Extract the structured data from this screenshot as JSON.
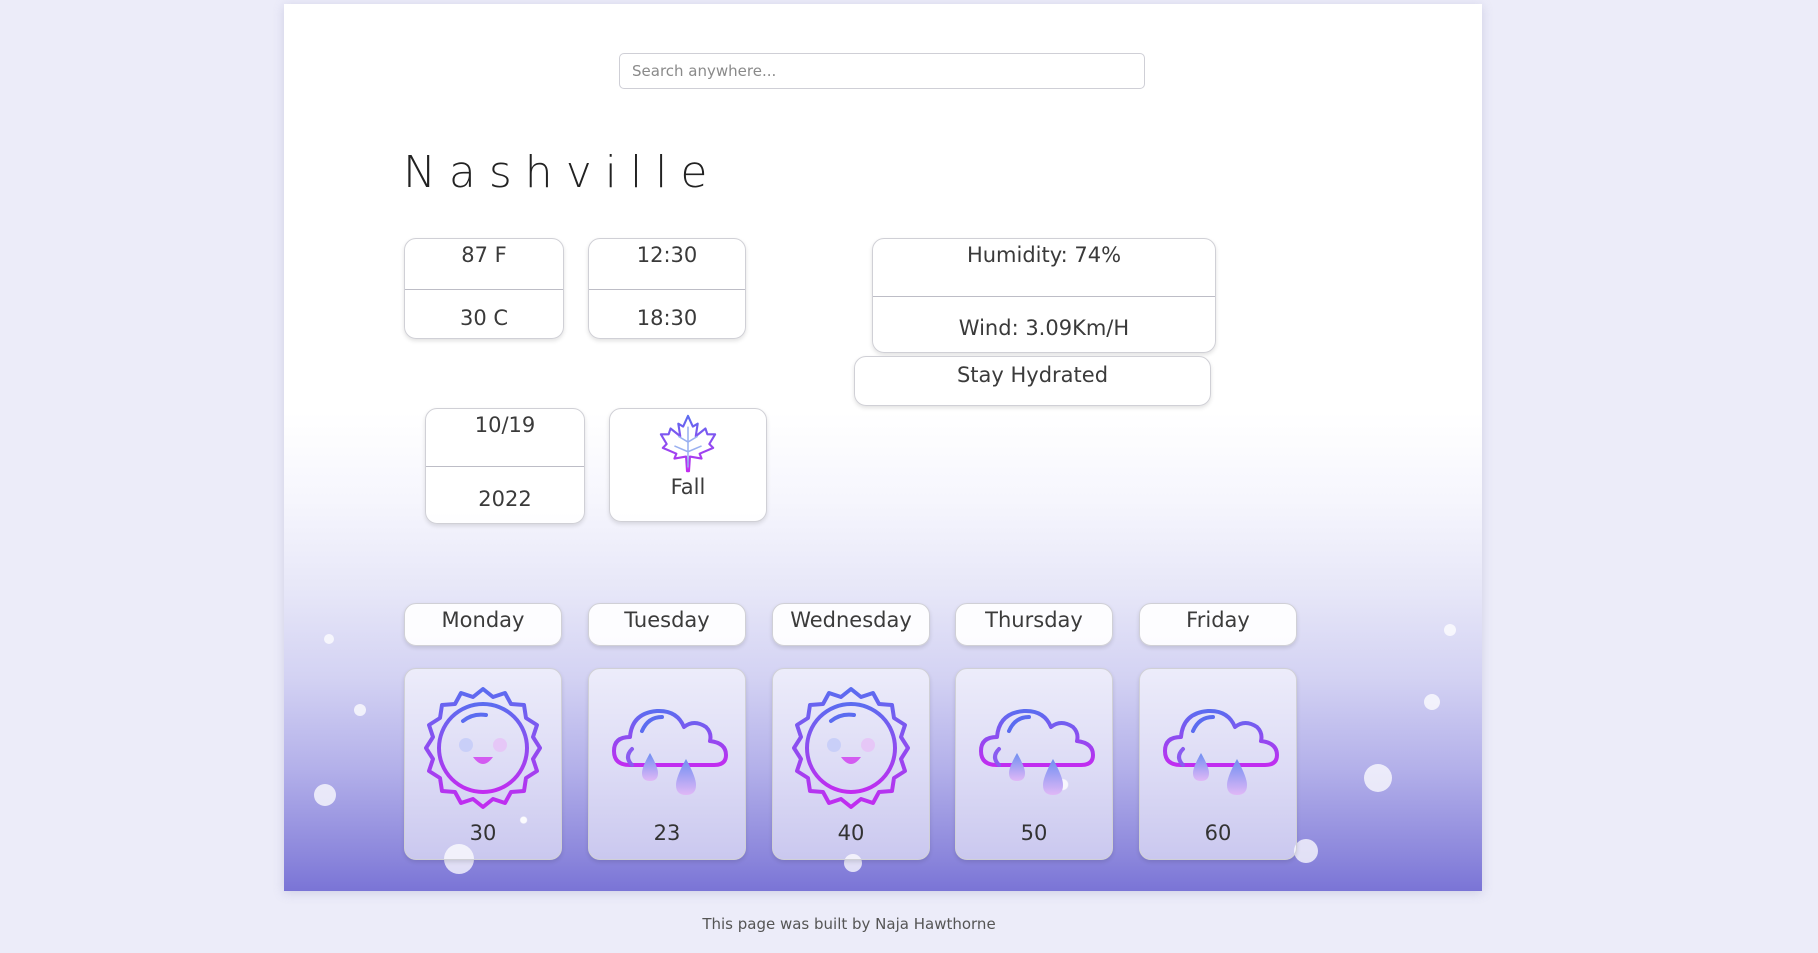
{
  "search": {
    "placeholder": "Search anywhere..."
  },
  "city": "Nashville",
  "temperature": {
    "fahrenheit": "87 F",
    "celsius": "30 C"
  },
  "time": {
    "first": "12:30",
    "second": "18:30"
  },
  "conditions": {
    "humidity": "Humidity: 74%",
    "wind": "Wind: 3.09Km/H"
  },
  "tip": "Stay Hydrated",
  "date": {
    "month_day": "10/19",
    "year": "2022"
  },
  "season": {
    "label": "Fall",
    "icon": "maple-leaf-icon"
  },
  "forecast": [
    {
      "day": "Monday",
      "temp": "30",
      "icon": "sun-icon"
    },
    {
      "day": "Tuesday",
      "temp": "23",
      "icon": "rain-cloud-icon"
    },
    {
      "day": "Wednesday",
      "temp": "40",
      "icon": "sun-icon"
    },
    {
      "day": "Thursday",
      "temp": "50",
      "icon": "rain-cloud-icon"
    },
    {
      "day": "Friday",
      "temp": "60",
      "icon": "rain-cloud-icon"
    }
  ],
  "footer": "This page was built by Naja Hawthorne",
  "colors": {
    "accent_blue": "#5b6cf0",
    "accent_purple": "#c22cf0",
    "background": "#ececf9"
  }
}
